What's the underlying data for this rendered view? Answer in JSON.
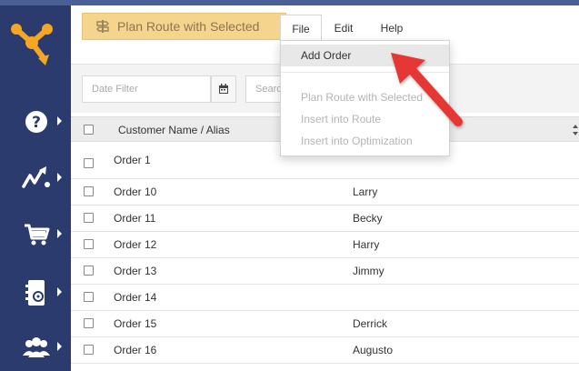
{
  "toolbar": {
    "plan_route_label": "Plan Route with Selected",
    "menus": [
      "File",
      "Edit",
      "Help"
    ]
  },
  "file_menu": {
    "items": [
      {
        "label": "Add Order",
        "enabled": true,
        "highlighted": true
      },
      {
        "label": "Plan Route with Selected",
        "enabled": false
      },
      {
        "label": "Insert into Route",
        "enabled": false
      },
      {
        "label": "Insert into Optimization",
        "enabled": false
      }
    ]
  },
  "filters": {
    "date_placeholder": "Date Filter",
    "search_placeholder": "Search"
  },
  "table": {
    "column_name": "Customer Name / Alias",
    "rows": [
      {
        "name": "Order 1",
        "alias": ""
      },
      {
        "name": "Order 10",
        "alias": "Larry"
      },
      {
        "name": "Order 11",
        "alias": "Becky"
      },
      {
        "name": "Order 12",
        "alias": "Harry"
      },
      {
        "name": "Order 13",
        "alias": "Jimmy"
      },
      {
        "name": "Order 14",
        "alias": ""
      },
      {
        "name": "Order 15",
        "alias": "Derrick"
      },
      {
        "name": "Order 16",
        "alias": "Augusto"
      }
    ]
  },
  "sidebar": {
    "items": [
      "help-icon",
      "routes-icon",
      "cart-icon",
      "address-book-icon",
      "team-icon"
    ]
  },
  "colors": {
    "sidebar_bg": "#2b3b6e",
    "logo_orange": "#f5a623",
    "plan_button_bg": "#f5d58e",
    "annotation_arrow": "#e53935"
  }
}
